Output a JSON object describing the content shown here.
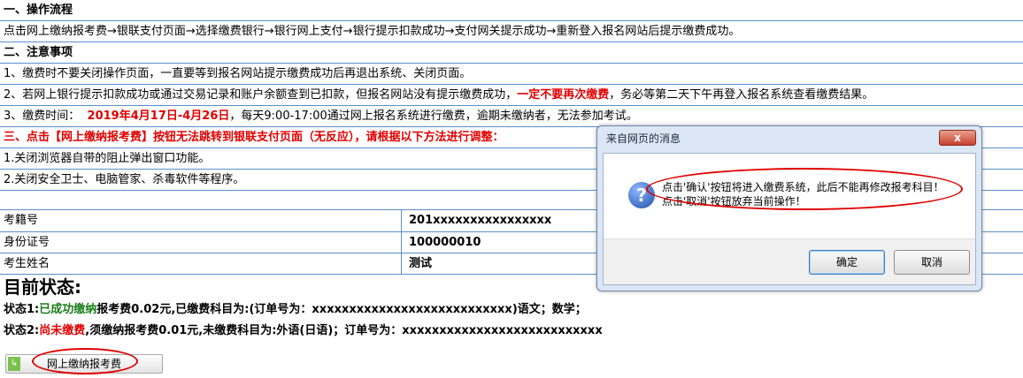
{
  "sections": {
    "flow_title": "一、操作流程",
    "flow_text": "点击网上缴纳报考费→银联支付页面→选择缴费银行→银行网上支付→银行提示扣款成功→支付网关提示成功→重新登入报名网站后提示缴费成功。",
    "notes_title": "二、注意事项",
    "note1": "1、缴费时不要关闭操作页面，一直要等到报名网站提示缴费成功后再退出系统、关闭页面。",
    "note2_pre": "2、若网上银行提示扣款成功或通过交易记录和账户余额查到已扣款，但报名网站没有提示缴费成功，",
    "note2_red": "一定不要再次缴费",
    "note2_post": "，务必等第二天下午再登入报名系统查看缴费结果。",
    "note3_pre": "3、缴费时间：",
    "note3_red": "2019年4月17日-4月26日",
    "note3_post": "，每天9:00-17:00通过网上报名系统进行缴费，逾期未缴纳者，无法参加考试。",
    "sec3_title": "三、点击【网上缴纳报考费】按钮无法跳转到银联支付页面（无反应），请根据以下方法进行调整：",
    "fix1": "1.关闭浏览器自带的阻止弹出窗口功能。",
    "fix2": "2.关闭安全卫士、电脑管家、杀毒软件等程序。"
  },
  "info": [
    {
      "label": "考籍号",
      "value": "201xxxxxxxxxxxxxxxx"
    },
    {
      "label": "身份证号",
      "value": "100000010"
    },
    {
      "label": "考生姓名",
      "value": "测试"
    }
  ],
  "status": {
    "title": "目前状态:",
    "s1_pre": "状态1:",
    "s1_green": "已成功缴纳",
    "s1_post": "报考费0.02元,已缴费科目为:(订单号为：xxxxxxxxxxxxxxxxxxxxxxxxxxx)语文；数学；",
    "s2_pre": "状态2:",
    "s2_red": "尚未缴费",
    "s2_post": ",须缴纳报考费0.01元,未缴费科目为:外语(日语)；订单号为：xxxxxxxxxxxxxxxxxxxxxxxxxxx"
  },
  "pay_button": "网上缴纳报考费",
  "dialog": {
    "title": "来自网页的消息",
    "close": "x",
    "icon": "question-icon",
    "line1": "点击'确认'按钮将进入缴费系统，此后不能再修改报考科目！",
    "line2": "点击'取消'按钮放弃当前操作！",
    "ok": "确定",
    "cancel": "取消"
  },
  "colors": {
    "accent_red": "#e00000",
    "success_green": "#1a7d1a",
    "grid_blue": "#5a8fc7"
  }
}
